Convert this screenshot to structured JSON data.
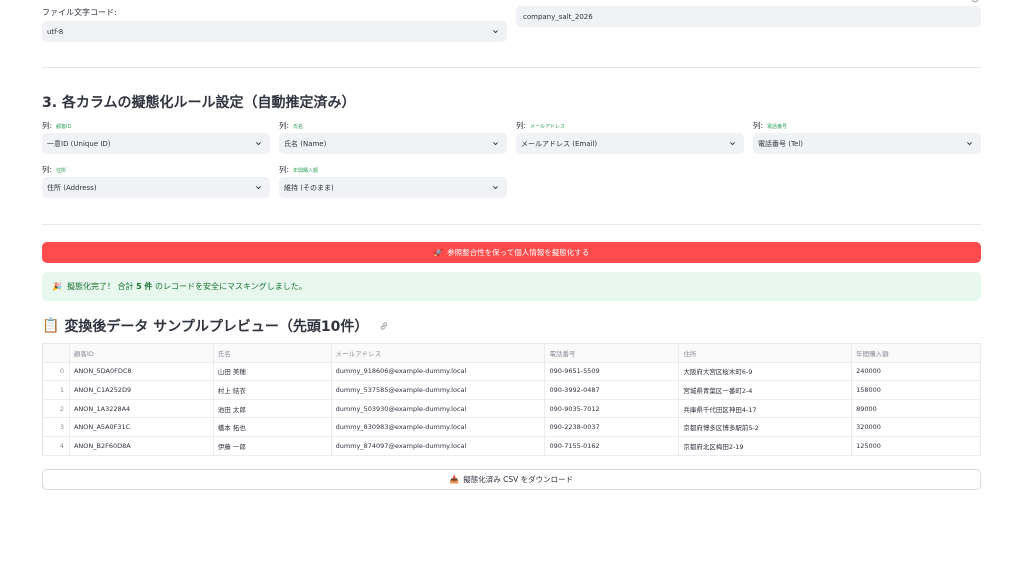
{
  "file_encoding": {
    "label": "ファイル文字コード:",
    "value": "utf-8"
  },
  "salt": {
    "value": "company_salt_2026"
  },
  "section3": {
    "title": "3. 各カラムの擬態化ルール設定（自動推定済み）",
    "col_prefix": "列:",
    "columns": [
      {
        "name": "顧客ID",
        "rule": "一意ID (Unique ID)"
      },
      {
        "name": "氏名",
        "rule": "氏名 (Name)"
      },
      {
        "name": "メールアドレス",
        "rule": "メールアドレス (Email)"
      },
      {
        "name": "電話番号",
        "rule": "電話番号 (Tel)"
      },
      {
        "name": "住所",
        "rule": "住所 (Address)"
      },
      {
        "name": "年間購入額",
        "rule": "維持 (そのまま)"
      }
    ]
  },
  "action": {
    "button_icon": "🚀",
    "button_label": "参照整合性を保って個人情報を擬態化する"
  },
  "success": {
    "icon": "🎉",
    "text_prefix": "擬態化完了！ 合計",
    "count": "5 件",
    "text_suffix": "のレコードを安全にマスキングしました。"
  },
  "preview": {
    "icon": "📋",
    "title": "変換後データ サンプルプレビュー（先頭10件）",
    "headers": [
      "",
      "顧客ID",
      "氏名",
      "メールアドレス",
      "電話番号",
      "住所",
      "年間購入額"
    ],
    "rows": [
      [
        "0",
        "ANON_5DA0FDC8",
        "山田 美穂",
        "dummy_918606@example-dummy.local",
        "090-9651-5509",
        "大阪府大宮区桜木町6-9",
        "240000"
      ],
      [
        "1",
        "ANON_C1A252D9",
        "村上 結衣",
        "dummy_537585@example-dummy.local",
        "090-3992-0487",
        "宮城県青葉区一番町2-4",
        "158000"
      ],
      [
        "2",
        "ANON_1A3228A4",
        "池田 太郎",
        "dummy_503930@example-dummy.local",
        "090-9035-7012",
        "兵庫県千代田区神田4-17",
        "89000"
      ],
      [
        "3",
        "ANON_A5A0F31C",
        "橋本 拓也",
        "dummy_830983@example-dummy.local",
        "090-2238-0037",
        "京都府博多区博多駅前5-2",
        "320000"
      ],
      [
        "4",
        "ANON_B2F60D8A",
        "伊藤 一郎",
        "dummy_874097@example-dummy.local",
        "090-7155-0162",
        "京都府北区梅田2-19",
        "125000"
      ]
    ]
  },
  "download": {
    "icon": "📥",
    "label": "擬態化済み CSV をダウンロード"
  }
}
